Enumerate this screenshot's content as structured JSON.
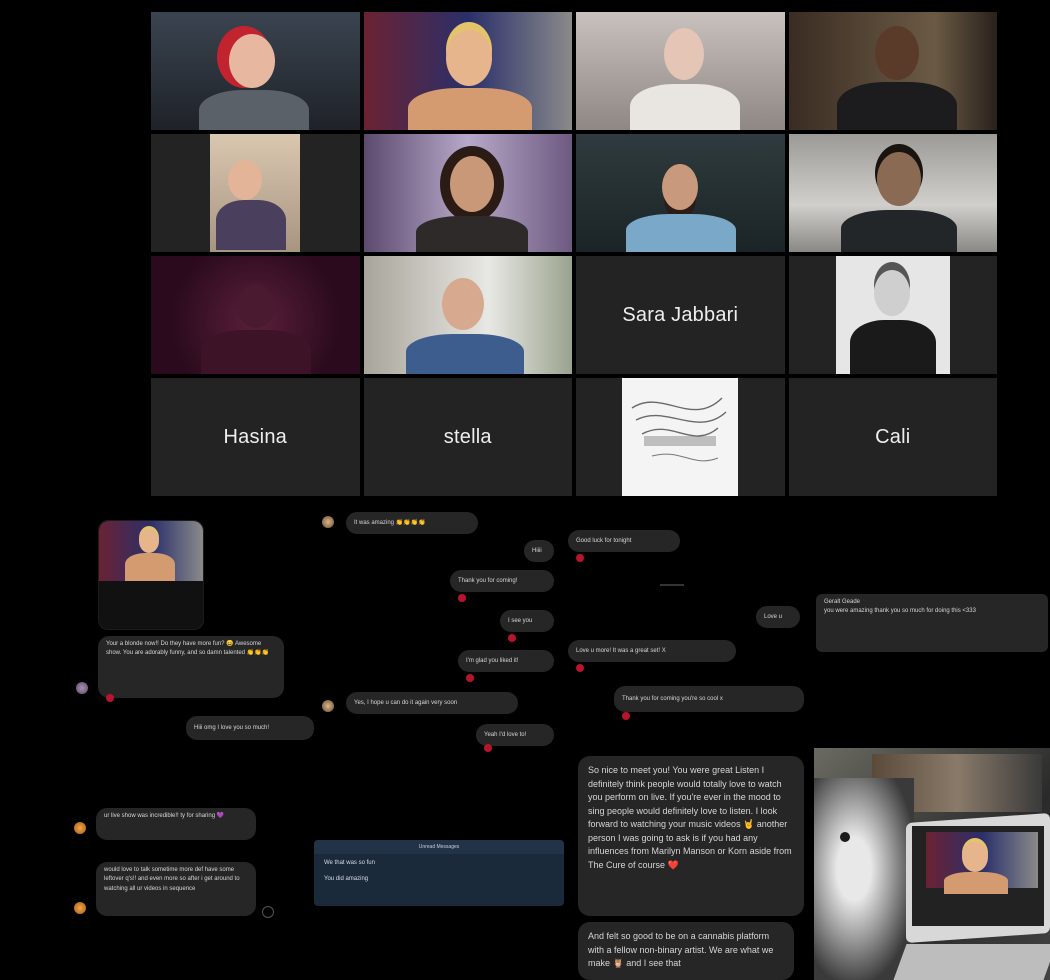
{
  "participants": [
    {
      "name": "",
      "type": "video"
    },
    {
      "name": "",
      "type": "video"
    },
    {
      "name": "",
      "type": "video",
      "active": true
    },
    {
      "name": "",
      "type": "video"
    },
    {
      "name": "",
      "type": "video"
    },
    {
      "name": "",
      "type": "video"
    },
    {
      "name": "",
      "type": "video"
    },
    {
      "name": "",
      "type": "video"
    },
    {
      "name": "",
      "type": "video"
    },
    {
      "name": "",
      "type": "video"
    },
    {
      "name": "Sara Jabbari",
      "type": "name"
    },
    {
      "name": "",
      "type": "video"
    },
    {
      "name": "Hasina",
      "type": "name"
    },
    {
      "name": "stella",
      "type": "name"
    },
    {
      "name": "",
      "type": "image"
    },
    {
      "name": "Cali",
      "type": "name"
    }
  ],
  "chats": {
    "left": {
      "blonde": "Your a blonde now!! Do they have more fun? 😄 Awesome show. You are adorably funny, and so damn talented 👏👏👏",
      "love_reply": "Hiii omg I love you so much!",
      "show_msg": "ur live show was incredible!! ty for sharing 💜",
      "talk_msg": "would love to talk sometime more def have some leftover q's!! and even more so after i get around to watching all ur videos in sequence"
    },
    "middle": {
      "amazing": "It was amazing 👏👏👏👏",
      "hiii": "Hiiii",
      "thank": "Thank you for coming!",
      "see": "I see you",
      "glad": "I'm glad you liked it!",
      "hope": "Yes, I hope u can do it again very soon",
      "yeah": "Yeah I'd love to!",
      "unread_header": "Unread Messages",
      "unread1": "We that was so fun",
      "unread2": "You did amazing"
    },
    "right": {
      "goodluck": "Good luck for tonight",
      "love_u": "Love u",
      "loved_it": "Love u more! It was a great set! X",
      "thanks_cool": "Thank you for coming you're so cool x",
      "reply_name": "Geralt Geade",
      "reply_text": "you were amazing thank you so much for doing this <333",
      "long1": "So nice to meet you! You were great Listen I definitely think people would totally love to watch you perform on live. If you're ever in the mood to sing people would definitely love to listen. I look forward to watching your music videos 🤘 another person I was going to ask is if you had any influences from Marilyn Manson or Korn aside from The Cure of course ❤️",
      "long2": "And felt so good to be on a cannabis platform with a fellow non-binary artist. We are what we make 🦉 and I see that"
    }
  },
  "colors": {
    "active_border": "#cbd96a",
    "heart": "#b8142e",
    "bubble": "#262626"
  }
}
